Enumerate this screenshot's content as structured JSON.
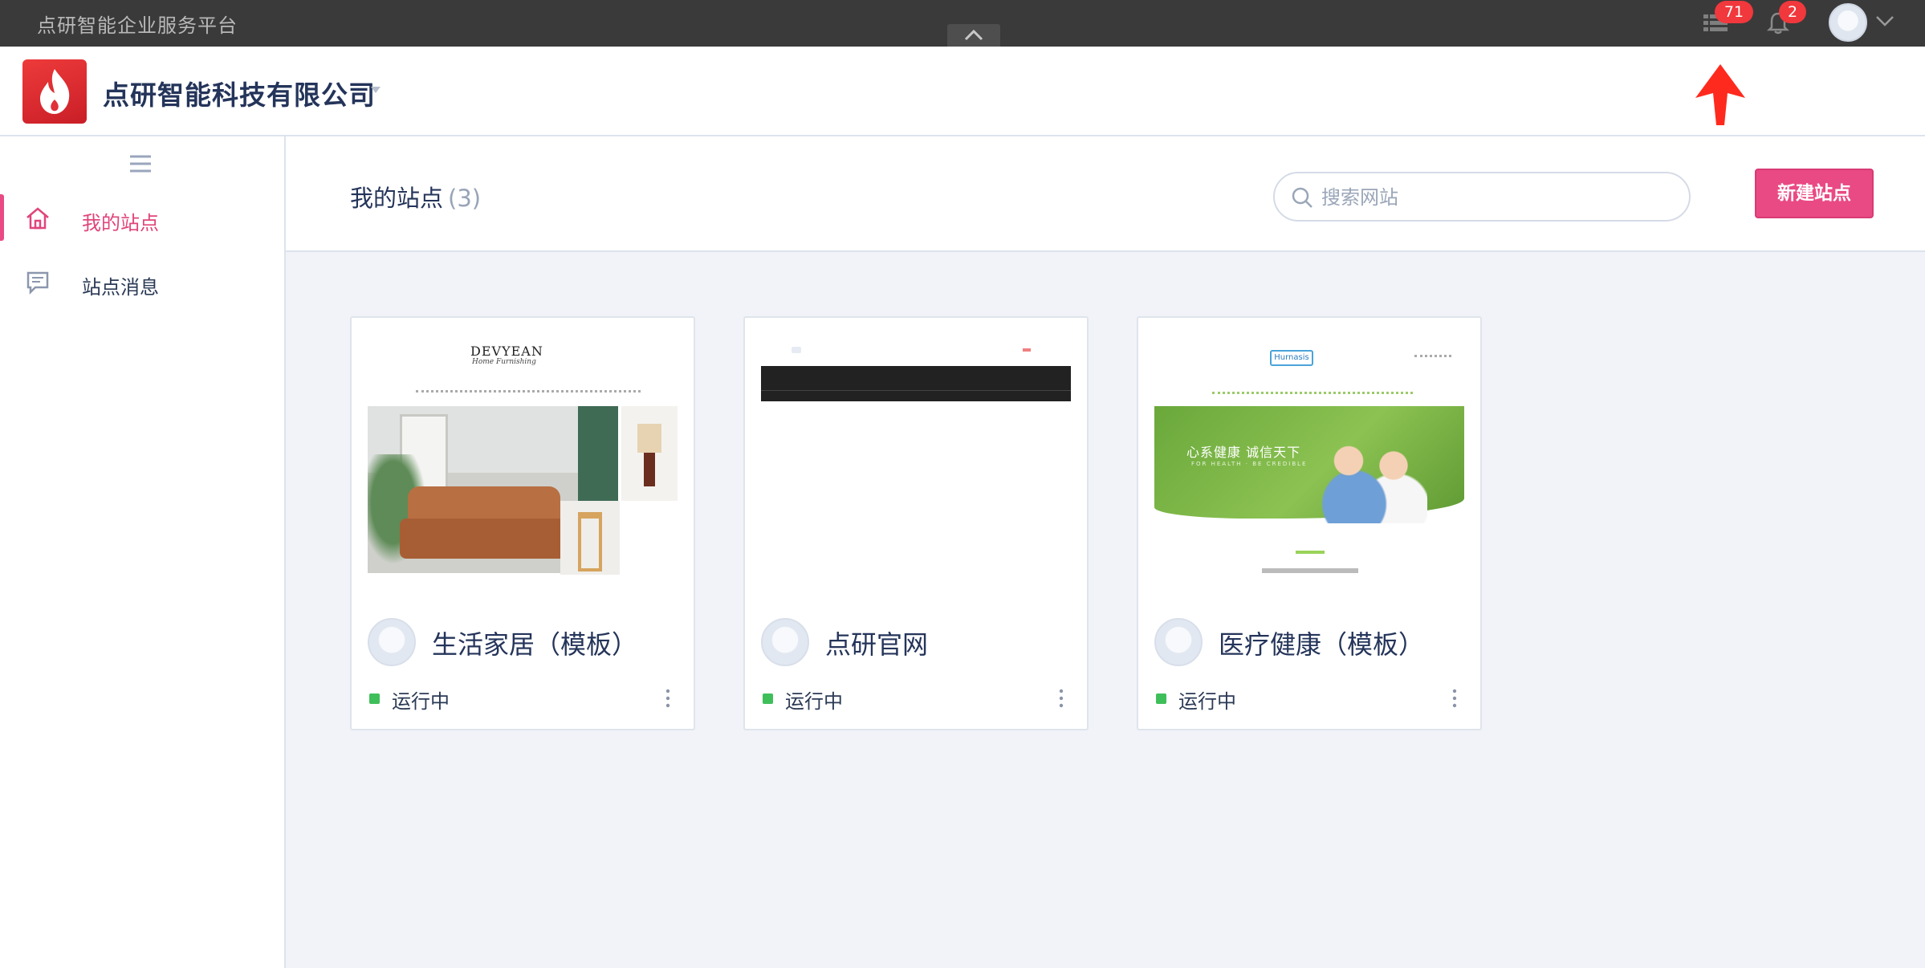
{
  "topbar": {
    "platform_title": "点研智能企业服务平台",
    "apps_badge": "71",
    "notify_badge": "2"
  },
  "header": {
    "company_name": "点研智能科技有限公司"
  },
  "sidebar": {
    "items": [
      {
        "label": "我的站点",
        "icon": "home-icon",
        "active": true
      },
      {
        "label": "站点消息",
        "icon": "message-icon",
        "active": false
      }
    ]
  },
  "main": {
    "title": "我的站点",
    "count": "(3)",
    "search_placeholder": "搜索网站",
    "new_site_label": "新建站点"
  },
  "sites": [
    {
      "name": "生活家居（模板）",
      "status": "运行中",
      "thumb_logo": "DEVYEAN",
      "thumb_logo_sub": "Home Furnishing"
    },
    {
      "name": "点研官网",
      "status": "运行中"
    },
    {
      "name": "医疗健康（模板）",
      "status": "运行中",
      "thumb_logo": "Hurnasis",
      "thumb_slogan": "心系健康 诚信天下",
      "thumb_slogan_sub": "FOR HEALTH · BE CREDIBLE"
    }
  ],
  "colors": {
    "accent": "#e94a84",
    "status_running": "#3fbf5a",
    "badge": "#f0383d",
    "topbar": "#3a3a3a"
  }
}
